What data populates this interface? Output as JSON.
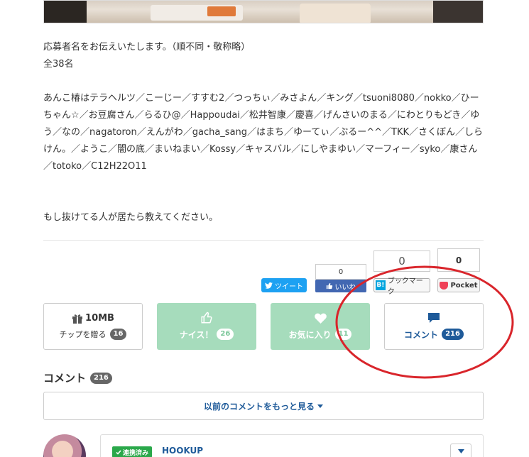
{
  "article": {
    "intro": "応募者名をお伝えいたします。（順不同・敬称略）",
    "count": "全38名",
    "names": "あんこ椿はテラヘルツ／こーじー／すすむ2／つっちぃ／みさよん／キング／tsuoni8080／nokko／ひーちゃん☆／お豆腐さん／らるひ@／Happoudai／松井智康／慶喜／げんさいのまる／にわとりもどき／ゆう／なの／nagatoron／えんがわ／gacha_sang／はまち／ゆーてぃ／ぶるー^^／TKK／さくぼん／しらけん。／ようこ／闇の底／まいねまい／Kossy／キャスバル／にしやまゆい／マーフィー／syko／康さん／totoko／C12H22O11",
    "closing": "もし抜けてる人が居たら教えてください。"
  },
  "social": {
    "tweet_label": "ツイート",
    "fb_count": "0",
    "fb_label": "いいね",
    "hatena_count": "0",
    "hatena_label": "ブックマーク",
    "pocket_count": "0",
    "pocket_label": "Pocket"
  },
  "actions": {
    "tip": {
      "size": "10MB",
      "label": "チップを贈る",
      "count": "16"
    },
    "nice": {
      "label": "ナイス！",
      "count": "26"
    },
    "favorite": {
      "label": "お気に入り",
      "count": "11"
    },
    "comment": {
      "label": "コメント",
      "count": "216"
    }
  },
  "comments": {
    "heading": "コメント",
    "count": "216",
    "more_label": "以前のコメントをもっと見る",
    "first": {
      "badge": "連携済み",
      "name": "HOOKUP"
    }
  },
  "colors": {
    "accent_blue": "#1e5a99",
    "green_button": "#a6dcbc",
    "twitter": "#1da1f2",
    "facebook": "#4267b2",
    "annotation_red": "#d9252b"
  }
}
